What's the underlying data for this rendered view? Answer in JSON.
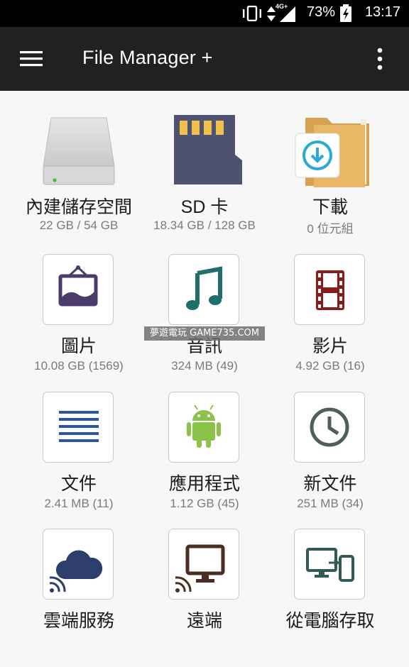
{
  "status_bar": {
    "network": "4G+",
    "battery": "73%",
    "time": "13:17"
  },
  "app_bar": {
    "title": "File Manager +",
    "menu_icon": "hamburger-menu-icon",
    "overflow_icon": "more-vert-icon"
  },
  "tiles": [
    {
      "label": "內建儲存空間",
      "sub": "22 GB / 54 GB",
      "icon": "hard-drive-icon"
    },
    {
      "label": "SD 卡",
      "sub": "18.34 GB / 128 GB",
      "icon": "sd-card-icon"
    },
    {
      "label": "下載",
      "sub": "0 位元組",
      "icon": "download-folder-icon"
    },
    {
      "label": "圖片",
      "sub": "10.08 GB (1569)",
      "icon": "picture-frame-icon",
      "color": "#4a3b6b"
    },
    {
      "label": "音訊",
      "sub": "324 MB (49)",
      "icon": "music-note-icon",
      "color": "#1f6e6a"
    },
    {
      "label": "影片",
      "sub": "4.92 GB (16)",
      "icon": "film-strip-icon",
      "color": "#8b1a1a"
    },
    {
      "label": "文件",
      "sub": "2.41 MB (11)",
      "icon": "document-lines-icon",
      "color": "#2a55a3"
    },
    {
      "label": "應用程式",
      "sub": "1.12 GB (45)",
      "icon": "android-icon",
      "color": "#8bc34a"
    },
    {
      "label": "新文件",
      "sub": "251 MB (34)",
      "icon": "clock-icon",
      "color": "#4e5f5e"
    },
    {
      "label": "雲端服務",
      "sub": "",
      "icon": "cloud-icon",
      "color": "#2c3e6b"
    },
    {
      "label": "遠端",
      "sub": "",
      "icon": "remote-monitor-icon",
      "color": "#4a2e22"
    },
    {
      "label": "從電腦存取",
      "sub": "",
      "icon": "pc-to-phone-icon",
      "color": "#2f5a55"
    }
  ],
  "watermark": "夢遊電玩 GAME735.COM"
}
